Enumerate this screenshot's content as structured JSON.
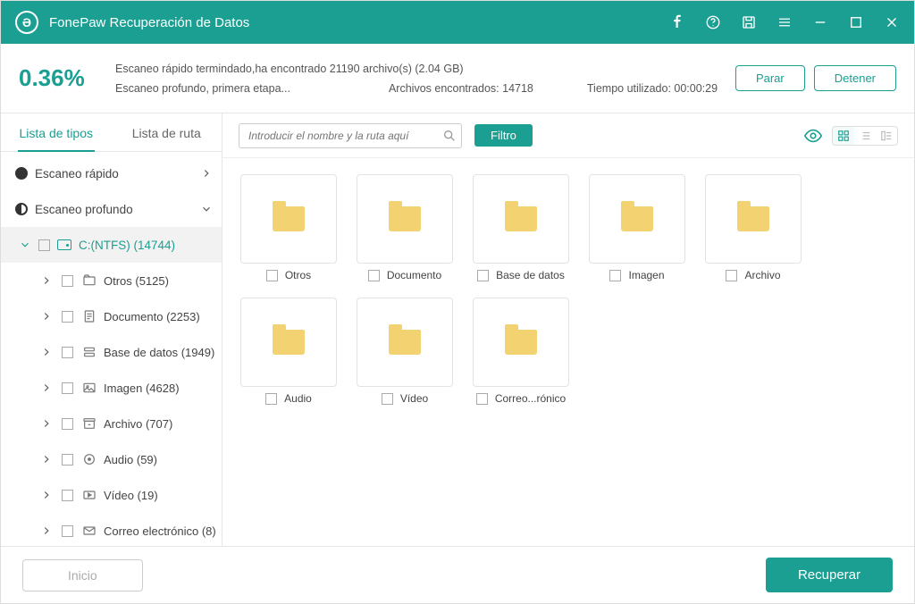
{
  "app": {
    "title": "FonePaw Recuperación de Datos"
  },
  "status": {
    "percent": "0.36%",
    "line1": "Escaneo rápido termindado,ha encontrado 21190 archivo(s) (2.04 GB)",
    "line2": "Escaneo profundo, primera etapa...",
    "found_label": "Archivos encontrados: 14718",
    "time_label": "Tiempo utilizado: 00:00:29",
    "btn_pause": "Parar",
    "btn_stop": "Detener"
  },
  "tabs": {
    "types": "Lista de tipos",
    "path": "Lista de ruta"
  },
  "tree": {
    "quick": "Escaneo rápido",
    "deep": "Escaneo profundo",
    "drive": "C:(NTFS) (14744)",
    "cats": [
      "Otros (5125)",
      "Documento (2253)",
      "Base de datos (1949)",
      "Imagen (4628)",
      "Archivo (707)",
      "Audio (59)",
      "Vídeo (19)",
      "Correo electrónico (8)"
    ]
  },
  "toolbar": {
    "search_placeholder": "Introducir el nombre y la ruta aquí",
    "filter": "Filtro"
  },
  "grid": [
    "Otros",
    "Documento",
    "Base de datos",
    "Imagen",
    "Archivo",
    "Audio",
    "Vídeo",
    "Correo...rónico"
  ],
  "footer": {
    "start": "Inicio",
    "recover": "Recuperar"
  }
}
